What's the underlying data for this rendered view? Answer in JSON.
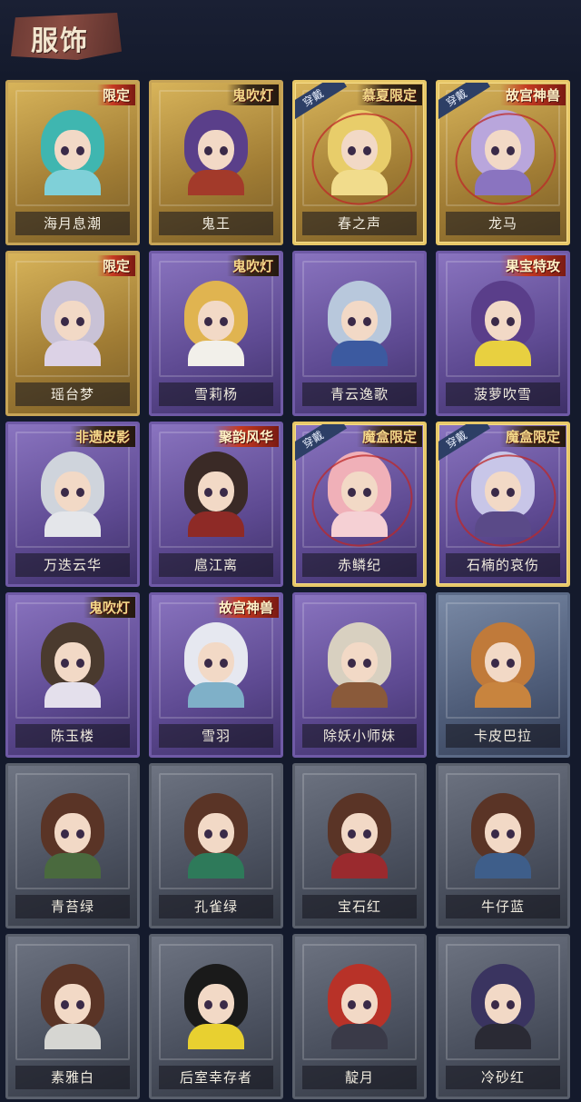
{
  "header": {
    "title": "服饰"
  },
  "tags": {
    "worn": "穿戴"
  },
  "costumes": [
    {
      "name": "海月息潮",
      "frame": "gold",
      "badge": "限定",
      "badge_style": "red",
      "worn": false,
      "hair": "#3fb6b0",
      "outfit": "#7fd0d8"
    },
    {
      "name": "鬼王",
      "frame": "gold",
      "badge": "鬼吹灯",
      "badge_style": "dark",
      "worn": false,
      "hair": "#5a3f8a",
      "outfit": "#a33a2a"
    },
    {
      "name": "春之声",
      "frame": "gold",
      "badge": "慕夏限定",
      "badge_style": "dark",
      "worn": true,
      "hair": "#e8cd6a",
      "outfit": "#f1dc8c"
    },
    {
      "name": "龙马",
      "frame": "gold",
      "badge": "故宫神兽",
      "badge_style": "red",
      "worn": true,
      "hair": "#b9a6dc",
      "outfit": "#8a74c0"
    },
    {
      "name": "瑶台梦",
      "frame": "gold",
      "badge": "限定",
      "badge_style": "red",
      "worn": false,
      "hair": "#c9c2d6",
      "outfit": "#dcd2e6"
    },
    {
      "name": "雪莉杨",
      "frame": "purple",
      "badge": "鬼吹灯",
      "badge_style": "dark",
      "worn": false,
      "hair": "#e0b450",
      "outfit": "#f2f0ea"
    },
    {
      "name": "青云逸歌",
      "frame": "purple",
      "badge": "",
      "badge_style": "",
      "worn": false,
      "hair": "#b8c8dc",
      "outfit": "#3c5aa0"
    },
    {
      "name": "菠萝吹雪",
      "frame": "purple",
      "badge": "果宝特攻",
      "badge_style": "red",
      "worn": false,
      "hair": "#5a3e8a",
      "outfit": "#e8d040"
    },
    {
      "name": "万迭云华",
      "frame": "purple",
      "badge": "非遗皮影",
      "badge_style": "dark",
      "worn": false,
      "hair": "#cfd4dc",
      "outfit": "#e4e6ea"
    },
    {
      "name": "扈江离",
      "frame": "purple",
      "badge": "聚韵风华",
      "badge_style": "red",
      "worn": false,
      "hair": "#3a2a26",
      "outfit": "#8e2a26"
    },
    {
      "name": "赤鳞纪",
      "frame": "purple",
      "badge": "魔盒限定",
      "badge_style": "dark",
      "worn": true,
      "hair": "#f0b0b8",
      "outfit": "#f5d0d4"
    },
    {
      "name": "石楠的哀伤",
      "frame": "purple",
      "badge": "魔盒限定",
      "badge_style": "dark",
      "worn": true,
      "hair": "#c8c6e8",
      "outfit": "#5a4a88"
    },
    {
      "name": "陈玉楼",
      "frame": "purple",
      "badge": "鬼吹灯",
      "badge_style": "dark",
      "worn": false,
      "hair": "#4a3a2e",
      "outfit": "#e4e0ec"
    },
    {
      "name": "雪羽",
      "frame": "purple",
      "badge": "故宫神兽",
      "badge_style": "red",
      "worn": false,
      "hair": "#e6e8f0",
      "outfit": "#7fb0c8"
    },
    {
      "name": "除妖小师妹",
      "frame": "purple",
      "badge": "",
      "badge_style": "",
      "worn": false,
      "hair": "#d8d0c0",
      "outfit": "#8a5a3a"
    },
    {
      "name": "卡皮巴拉",
      "frame": "blue",
      "badge": "",
      "badge_style": "",
      "worn": false,
      "hair": "#c07a3a",
      "outfit": "#c8843e"
    },
    {
      "name": "青苔绿",
      "frame": "gray",
      "badge": "",
      "badge_style": "",
      "worn": false,
      "hair": "#5a3426",
      "outfit": "#4a6a3e"
    },
    {
      "name": "孔雀绿",
      "frame": "gray",
      "badge": "",
      "badge_style": "",
      "worn": false,
      "hair": "#5a3426",
      "outfit": "#2e7a5a"
    },
    {
      "name": "宝石红",
      "frame": "gray",
      "badge": "",
      "badge_style": "",
      "worn": false,
      "hair": "#5a3426",
      "outfit": "#9a2a2e"
    },
    {
      "name": "牛仔蓝",
      "frame": "gray",
      "badge": "",
      "badge_style": "",
      "worn": false,
      "hair": "#5a3426",
      "outfit": "#3e5e8a"
    },
    {
      "name": "素雅白",
      "frame": "gray",
      "badge": "",
      "badge_style": "",
      "worn": false,
      "hair": "#5a3426",
      "outfit": "#d6d6d2"
    },
    {
      "name": "后室幸存者",
      "frame": "gray",
      "badge": "",
      "badge_style": "",
      "worn": false,
      "hair": "#1a1a1a",
      "outfit": "#e8d030"
    },
    {
      "name": "靛月",
      "frame": "gray",
      "badge": "",
      "badge_style": "",
      "worn": false,
      "hair": "#b83228",
      "outfit": "#3a3a48"
    },
    {
      "name": "冷砂红",
      "frame": "gray",
      "badge": "",
      "badge_style": "",
      "worn": false,
      "hair": "#3a3460",
      "outfit": "#2a2a34"
    }
  ]
}
